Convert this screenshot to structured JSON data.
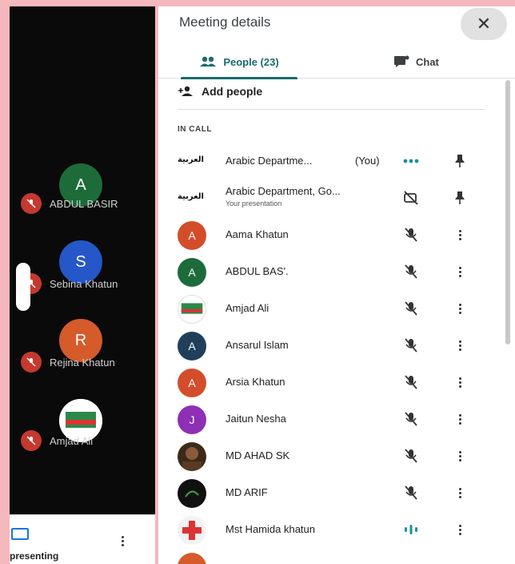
{
  "left_strip": {
    "tiles": [
      {
        "initial": "A",
        "name": "ABDUL BASIR",
        "color": "#1e6b3a"
      },
      {
        "initial": "S",
        "name": "Sebina Khatun",
        "color": "#2557c9"
      },
      {
        "initial": "R",
        "name": "Rejina Khatun",
        "color": "#d55b2a"
      },
      {
        "initial": "",
        "name": "Amjad Ali",
        "color": "#ffffff"
      }
    ],
    "presenting_label": "presenting"
  },
  "panel": {
    "title": "Meeting details",
    "tabs": {
      "people": "People (23)",
      "chat": "Chat"
    },
    "add_people": "Add people",
    "section_label": "IN CALL",
    "participants": [
      {
        "name": "Arabic Departme...",
        "suffix": "(You)",
        "sub": "",
        "avatar": "logo",
        "initial": "",
        "color": "#ffffff",
        "status": "speaking-dots",
        "action": "pin",
        "logo_text": "العربية"
      },
      {
        "name": "Arabic Department, Go...",
        "suffix": "",
        "sub": "Your presentation",
        "avatar": "logo",
        "initial": "",
        "color": "#ffffff",
        "status": "presentation-off",
        "action": "pin",
        "logo_text": "العربية"
      },
      {
        "name": "Aama Khatun",
        "suffix": "",
        "sub": "",
        "avatar": "initial",
        "initial": "A",
        "color": "#d34d2a",
        "status": "muted",
        "action": "more"
      },
      {
        "name": "ABDUL BAS'.",
        "suffix": "",
        "sub": "",
        "avatar": "initial",
        "initial": "A",
        "color": "#1e6b3a",
        "status": "muted",
        "action": "more"
      },
      {
        "name": "Amjad Ali",
        "suffix": "",
        "sub": "",
        "avatar": "image",
        "initial": "",
        "color": "#ffffff",
        "status": "muted",
        "action": "more"
      },
      {
        "name": "Ansarul Islam",
        "suffix": "",
        "sub": "",
        "avatar": "initial",
        "initial": "A",
        "color": "#1f3f5a",
        "status": "muted",
        "action": "more"
      },
      {
        "name": "Arsia Khatun",
        "suffix": "",
        "sub": "",
        "avatar": "initial",
        "initial": "A",
        "color": "#d34d2a",
        "status": "muted",
        "action": "more"
      },
      {
        "name": "Jaitun Nesha",
        "suffix": "",
        "sub": "",
        "avatar": "initial",
        "initial": "J",
        "color": "#8e2fb5",
        "status": "muted",
        "action": "more"
      },
      {
        "name": "MD AHAD SK",
        "suffix": "",
        "sub": "",
        "avatar": "image",
        "initial": "",
        "color": "#3b2a1a",
        "status": "muted",
        "action": "more"
      },
      {
        "name": "MD ARIF",
        "suffix": "",
        "sub": "",
        "avatar": "image",
        "initial": "",
        "color": "#111111",
        "status": "muted",
        "action": "more"
      },
      {
        "name": "Mst Hamida khatun",
        "suffix": "",
        "sub": "",
        "avatar": "image",
        "initial": "",
        "color": "#f2f2f2",
        "status": "speaking",
        "action": "more"
      }
    ]
  },
  "colors": {
    "accent": "#1a6b6e",
    "mic_red": "#c5392f",
    "speaking": "#1a8fa0"
  }
}
